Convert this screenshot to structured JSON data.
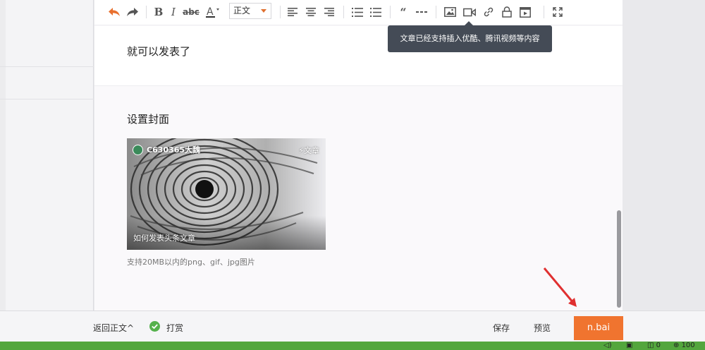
{
  "toolbar": {
    "style_select": "正文",
    "tooltip": "文章已经支持插入优酷、腾讯视频等内容"
  },
  "editor": {
    "paragraph": "就可以发表了"
  },
  "cover": {
    "title": "设置封面",
    "author": "C630365大魏",
    "tag": "⚡文章",
    "caption": "如何发表头条文章",
    "note": "支持20MB以内的png、gif、jpg图片"
  },
  "bottom": {
    "back_label": "返回正文^",
    "reward_label": "打赏",
    "save_label": "保存",
    "preview_label": "预览",
    "publish_label": "n.bai"
  },
  "taskbar": {
    "tray_1": "0",
    "tray_2": "100"
  },
  "colors": {
    "accent": "#f0742f",
    "tooltip_bg": "#444b56",
    "taskbar": "#53a63d",
    "check": "#55b14c"
  }
}
